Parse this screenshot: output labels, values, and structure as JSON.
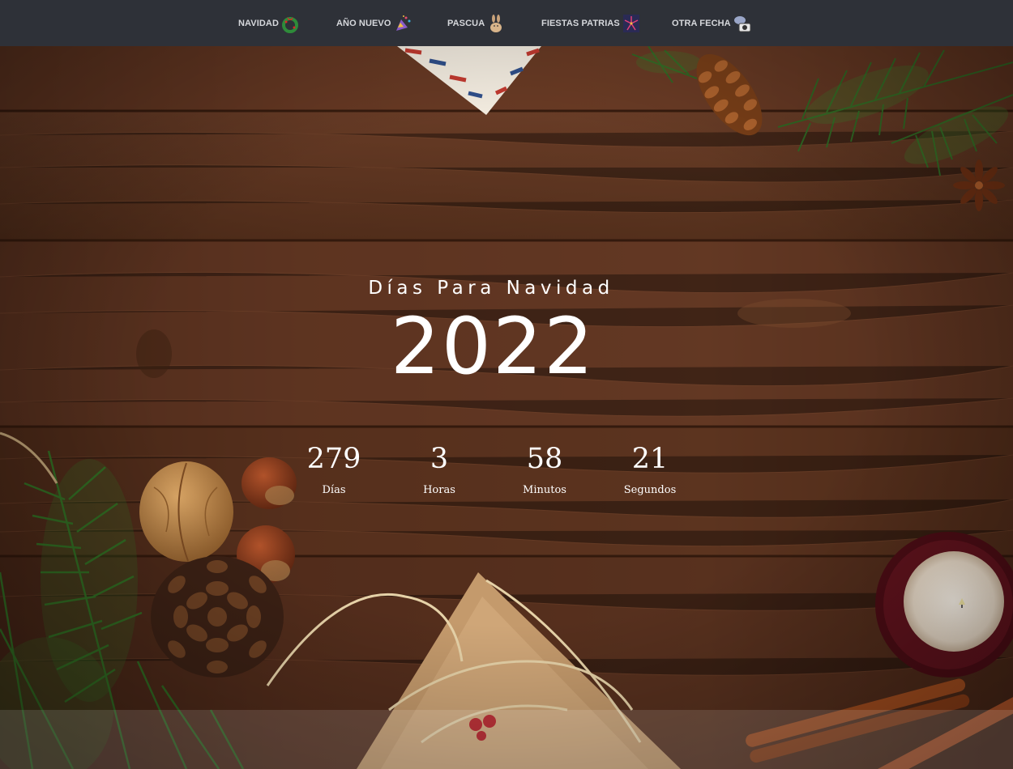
{
  "nav": {
    "items": [
      {
        "label": "NAVIDAD",
        "icon": "wreath-icon"
      },
      {
        "label": "AÑO NUEVO",
        "icon": "party-popper-icon"
      },
      {
        "label": "PASCUA",
        "icon": "rabbit-icon"
      },
      {
        "label": "FIESTAS PATRIAS",
        "icon": "fireworks-icon"
      },
      {
        "label": "OTRA FECHA",
        "icon": "camera-icon"
      }
    ]
  },
  "hero": {
    "subtitle": "Días Para Navidad",
    "year": "2022"
  },
  "countdown": [
    {
      "value": "279",
      "label": "Días"
    },
    {
      "value": "3",
      "label": "Horas"
    },
    {
      "value": "58",
      "label": "Minutos"
    },
    {
      "value": "21",
      "label": "Segundos"
    }
  ],
  "colors": {
    "navbar": "#2e3138",
    "wood": "#5a3320",
    "text": "#ffffff"
  }
}
